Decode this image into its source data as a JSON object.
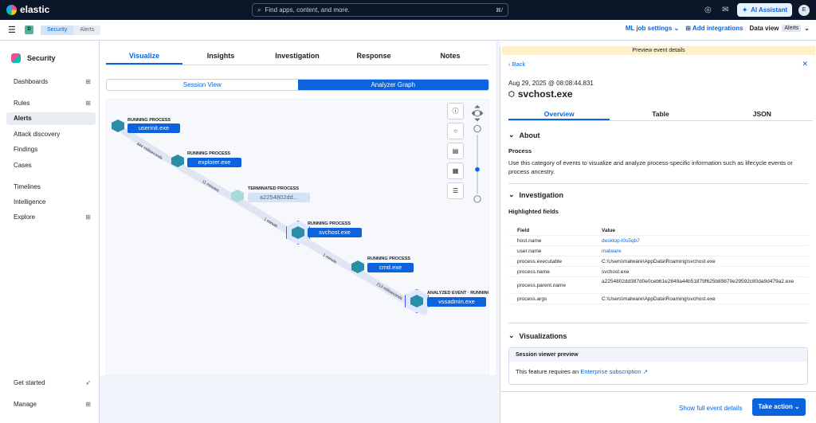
{
  "brand": "elastic",
  "search": {
    "placeholder": "Find apps, content, and more.",
    "shortcut": "⌘/"
  },
  "topbar": {
    "ai_label": "AI Assistant",
    "avatar": "E"
  },
  "subbar": {
    "space_badge": "D",
    "breadcrumbs": [
      "Security",
      "Alerts"
    ],
    "ml_label": "ML job settings",
    "integrations_label": "Add integrations",
    "dataview_label": "Data view",
    "dataview_value": "Alerts"
  },
  "sidebar": {
    "title": "Security",
    "items": [
      "Dashboards",
      "Rules",
      "Alerts",
      "Attack discovery",
      "Findings",
      "Cases",
      "Timelines",
      "Intelligence",
      "Explore"
    ],
    "bottom": [
      "Get started",
      "Manage"
    ]
  },
  "main": {
    "tabs": [
      "Visualize",
      "Insights",
      "Investigation",
      "Response",
      "Notes"
    ],
    "views": [
      "Session View",
      "Analyzer Graph"
    ]
  },
  "graph": {
    "nodes": [
      {
        "state": "RUNNING PROCESS",
        "name": "userinit.exe"
      },
      {
        "state": "RUNNING PROCESS",
        "name": "explorer.exe"
      },
      {
        "state": "TERMINATED PROCESS",
        "name": "a2254802dd..."
      },
      {
        "state": "RUNNING PROCESS",
        "name": "svchost.exe"
      },
      {
        "state": "RUNNING PROCESS",
        "name": "cmd.exe"
      },
      {
        "state": "ANALYZED EVENT · RUNNING",
        "name": "vssadmin.exe"
      }
    ],
    "edges": [
      "444 milliseconds",
      "11 minutes",
      "1 minute",
      "1 minute",
      "213 milliseconds"
    ]
  },
  "flyout": {
    "banner": "Preview event details",
    "back": "Back",
    "timestamp": "Aug 29, 2025 @ 08:08:44.831",
    "title": "svchost.exe",
    "tabs": [
      "Overview",
      "Table",
      "JSON"
    ],
    "about": "About",
    "process_title": "Process",
    "process_desc": "Use this category of events to visualize and analyze process-specific information such as lifecycle events or process ancestry.",
    "investigation": "Investigation",
    "highlighted": "Highlighted fields",
    "col_field": "Field",
    "col_value": "Value",
    "fields": [
      {
        "f": "host.name",
        "v": "desktop-l0s5qb7"
      },
      {
        "f": "user.name",
        "v": "malware"
      },
      {
        "f": "process.executable",
        "v": "C:\\Users\\malware\\AppData\\Roaming\\svchost.exe"
      },
      {
        "f": "process.name",
        "v": "svchost.exe"
      },
      {
        "f": "process.parent.name",
        "v": "a2254802dd387d0e0ceb61e2849a44b51879f625b89879e29592c80da9d479a2.exe"
      },
      {
        "f": "process.args",
        "v": "C:\\Users\\malware\\AppData\\Roaming\\svchost.exe"
      }
    ],
    "visualizations": "Visualizations",
    "sv_head": "Session viewer preview",
    "sv_text": "This feature requires an",
    "sv_link": "Enterprise subscription",
    "show_full": "Show full event details",
    "take_action": "Take action"
  }
}
